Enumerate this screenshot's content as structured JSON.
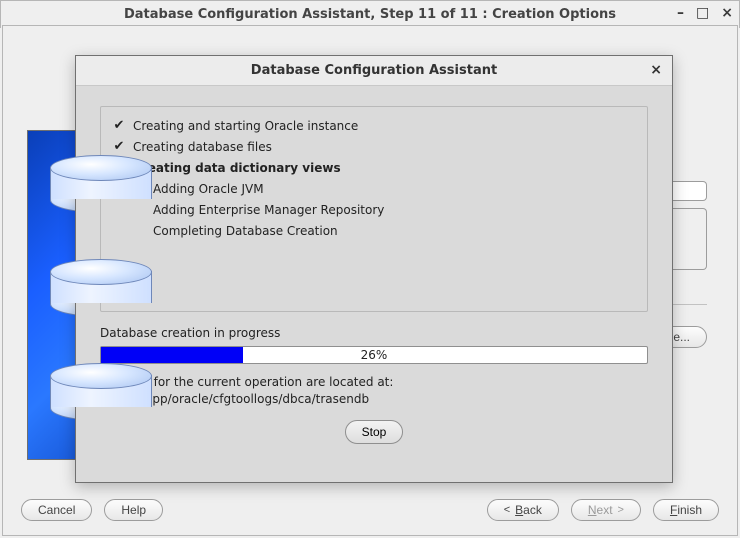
{
  "window": {
    "title": "Database Configuration Assistant, Step 11 of 11 : Creation Options"
  },
  "peek": {
    "browse": "Browse..."
  },
  "footer": {
    "cancel": "Cancel",
    "help": "Help",
    "back": "Back",
    "next": "Next",
    "finish": "Finish"
  },
  "modal": {
    "title": "Database Configuration Assistant",
    "steps": [
      {
        "label": "Creating and starting Oracle instance",
        "state": "done"
      },
      {
        "label": "Creating database files",
        "state": "done"
      },
      {
        "label": "Creating data dictionary views",
        "state": "current"
      },
      {
        "label": "Adding Oracle JVM",
        "state": "pending"
      },
      {
        "label": "Adding Enterprise Manager Repository",
        "state": "pending"
      },
      {
        "label": "Completing Database Creation",
        "state": "pending"
      }
    ],
    "status": "Database creation in progress",
    "progress_percent": 26,
    "progress_label": "26%",
    "log_intro": "Log files for the current operation are located at:",
    "log_path": "/oracle/app/oracle/cfgtoollogs/dbca/trasendb",
    "stop": "Stop"
  }
}
